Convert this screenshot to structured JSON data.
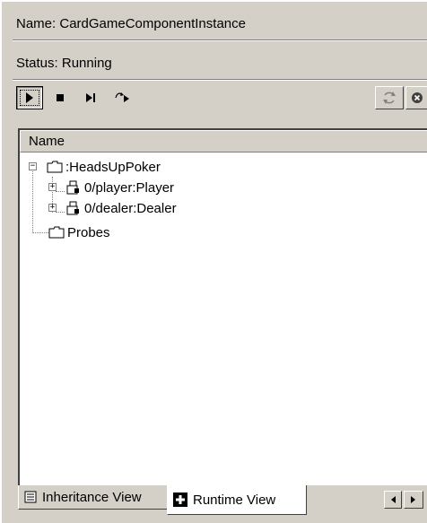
{
  "info": {
    "name_label": "Name:",
    "name_value": "CardGameComponentInstance",
    "status_label": "Status:",
    "status_value": "Running"
  },
  "toolbar": {
    "left_buttons": [
      "run-icon",
      "stop-icon",
      "step-icon",
      "step-over-icon"
    ],
    "right_buttons": [
      "refresh-icon",
      "close-icon"
    ]
  },
  "tree": {
    "column_header": "Name",
    "items": [
      {
        "label": ":HeadsUpPoker",
        "icon": "folder-icon",
        "expander": "−"
      },
      {
        "label": "0/player:Player",
        "icon": "component-icon",
        "expander": "+"
      },
      {
        "label": "0/dealer:Dealer",
        "icon": "component-icon",
        "expander": "+"
      },
      {
        "label": "Probes",
        "icon": "folder-icon",
        "expander": ""
      }
    ]
  },
  "tabs": [
    {
      "label": "Inheritance View",
      "icon": "document-icon",
      "active": false
    },
    {
      "label": "Runtime View",
      "icon": "runtime-icon",
      "active": true
    }
  ],
  "colors": {
    "background": "#d4d0c8",
    "panel": "#ffffff",
    "shadow": "#808080"
  }
}
